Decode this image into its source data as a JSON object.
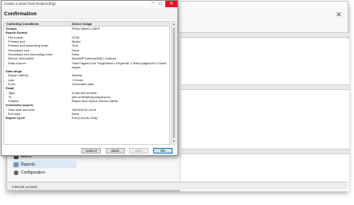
{
  "background_app": {
    "nav_items": [
      {
        "label": "Alerts",
        "icon": "bell-icon"
      },
      {
        "label": "Reports",
        "icon": "report-icon",
        "selected": true
      },
      {
        "label": "Configuration",
        "icon": "gear-icon"
      }
    ],
    "status_text": "Internet access"
  },
  "dialog": {
    "title": "Create a report (Not Responding)",
    "heading": "Confirmation",
    "grid": {
      "header": {
        "key": "Collecting Conditions",
        "value": "Device Usage"
      },
      "rows": [
        {
          "type": "section",
          "key": "Groups",
          "value": "\\Rimu office\\LJ-MFP"
        },
        {
          "type": "section",
          "key": "Report Format",
          "value": ""
        },
        {
          "type": "item",
          "key": "File format",
          "value": "HTML"
        },
        {
          "type": "item",
          "key": "Primary sort",
          "value": "Model"
        },
        {
          "type": "item",
          "key": "Primary sort ascending order",
          "value": "True"
        },
        {
          "type": "item",
          "key": "Secondary sort",
          "value": "None"
        },
        {
          "type": "item",
          "key": "Secondary sort Ascending order",
          "value": "False"
        },
        {
          "type": "item",
          "key": "Device information",
          "value": "Model/IP Address/MAC Address"
        },
        {
          "type": "item",
          "key": "Data column",
          "value": "Total Pages/Color Pages/Mono Pages/All 1-Sided pages/All 2-Sided"
        },
        {
          "type": "cont",
          "key": "",
          "value": "pages"
        },
        {
          "type": "section",
          "key": "Data range",
          "value": ""
        },
        {
          "type": "item",
          "key": "Report interval",
          "value": "Weekly"
        },
        {
          "type": "item",
          "key": "Last",
          "value": "1 Month"
        },
        {
          "type": "item",
          "key": "From",
          "value": "Generated date"
        },
        {
          "type": "section",
          "key": "Email",
          "value": ""
        },
        {
          "type": "item",
          "key": "Type",
          "value": "Email and archive"
        },
        {
          "type": "item",
          "key": "To",
          "value": "john.smith@mycompany.eu"
        },
        {
          "type": "item",
          "key": "Subject",
          "value": "Report from Epson Device Admin"
        },
        {
          "type": "section",
          "key": "Scheduled reports",
          "value": ""
        },
        {
          "type": "item",
          "key": "Start date and time",
          "value": "15/09/2015 16:44"
        },
        {
          "type": "item",
          "key": "End date",
          "value": "None"
        },
        {
          "type": "section",
          "key": "Report Cycle",
          "value": "Every month 1Day"
        }
      ]
    },
    "buttons": {
      "cancel": "Cancel",
      "back": "Back",
      "next": "Next",
      "ok": "OK"
    }
  }
}
